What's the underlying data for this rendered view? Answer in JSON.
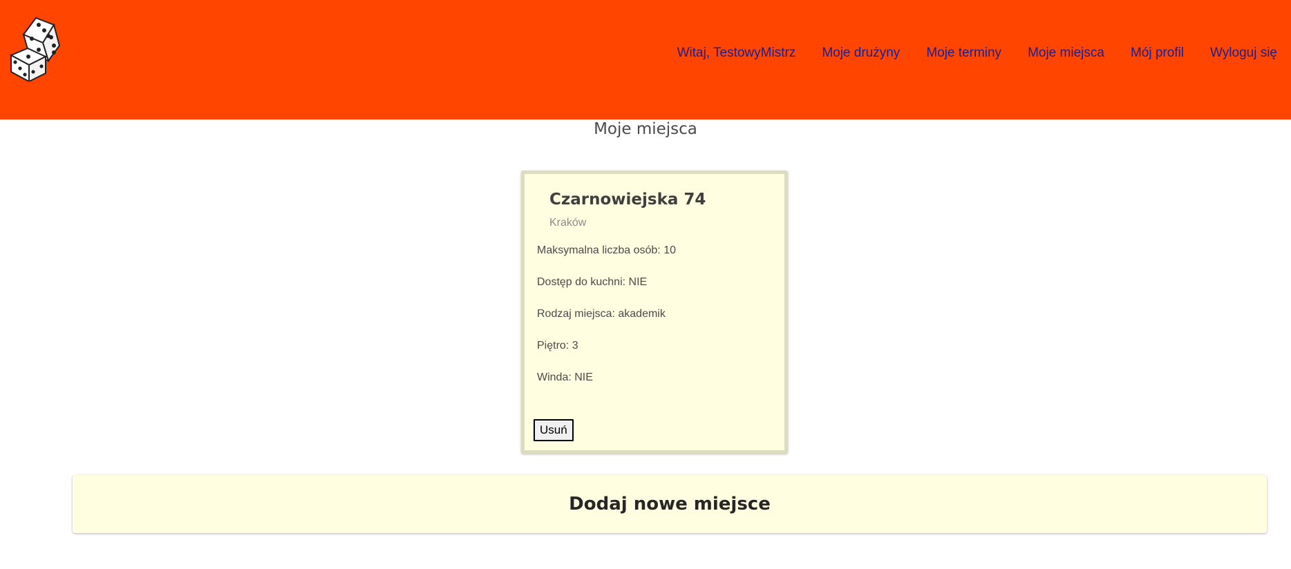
{
  "nav": {
    "items": [
      {
        "label": "Witaj, TestowyMistrz"
      },
      {
        "label": "Moje drużyny"
      },
      {
        "label": "Moje terminy"
      },
      {
        "label": "Moje miejsca"
      },
      {
        "label": "Mój profil"
      },
      {
        "label": "Wyloguj się"
      }
    ]
  },
  "page": {
    "title": "Moje miejsca"
  },
  "place": {
    "name": "Czarnowiejska 74",
    "city": "Kraków",
    "details": [
      "Maksymalna liczba osób: 10",
      "Dostęp do kuchni: NIE",
      "Rodzaj miejsca: akademik",
      "Piętro: 3",
      "Winda: NIE"
    ],
    "delete_label": "Usuń"
  },
  "add_place": {
    "label": "Dodaj nowe miejsce"
  },
  "colors": {
    "header": "#ff4500",
    "nav_link": "#1e1e8c",
    "card_bg": "#fffee0"
  },
  "icons": {
    "logo": "dice-logo-icon"
  }
}
